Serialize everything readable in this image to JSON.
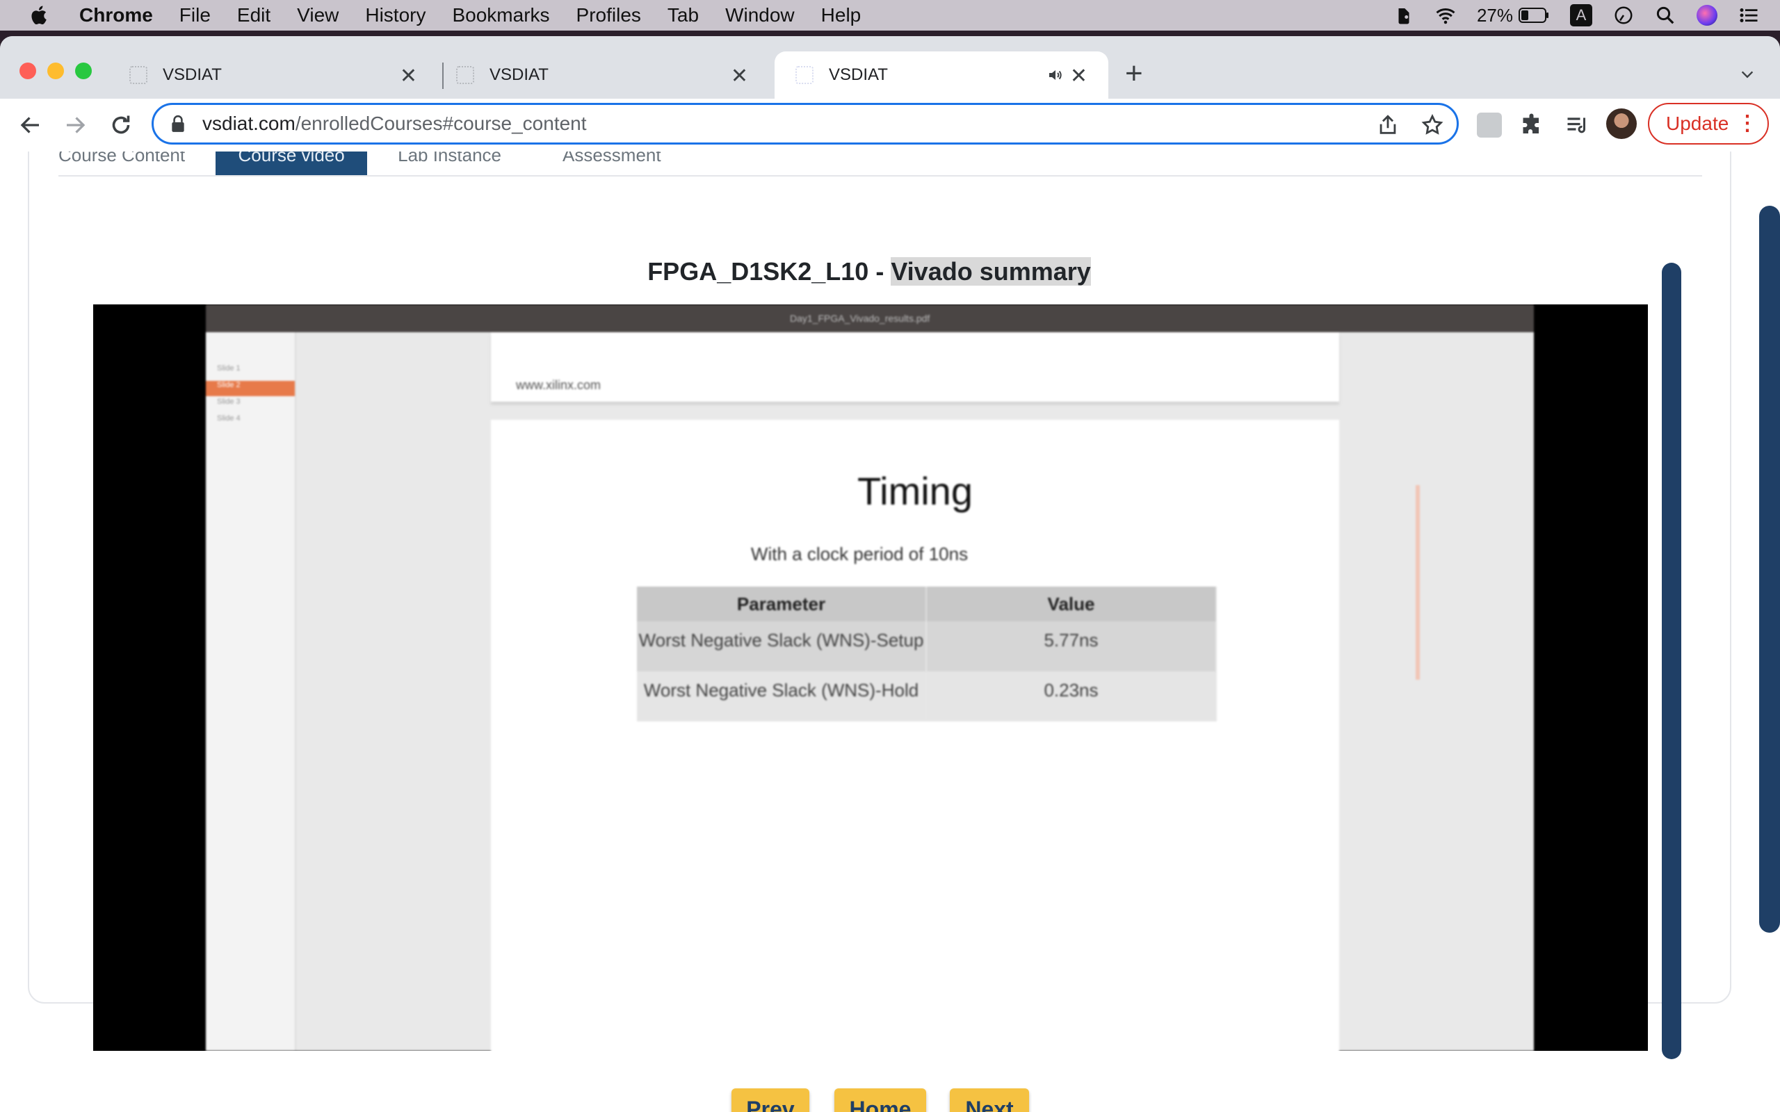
{
  "menubar": {
    "app_name": "Chrome",
    "items": [
      "File",
      "Edit",
      "View",
      "History",
      "Bookmarks",
      "Profiles",
      "Tab",
      "Window",
      "Help"
    ],
    "battery_percent": "27%",
    "input_source": "A"
  },
  "browser": {
    "tabs": [
      {
        "title": "VSDIAT",
        "active": false
      },
      {
        "title": "VSDIAT",
        "active": false
      },
      {
        "title": "VSDIAT",
        "active": true,
        "audio": true
      }
    ],
    "url_host": "vsdiat.com",
    "url_path": "/enrolledCourses#course_content",
    "update_label": "Update"
  },
  "course": {
    "tabs": [
      "Course Content",
      "Course video",
      "Lab Instance",
      "Assessment"
    ],
    "active_tab": "Course video",
    "video_title_prefix": "FPGA_D1SK2_L10 - ",
    "video_title_highlight": "Vivado summary"
  },
  "video": {
    "viewer_filename": "Day1_FPGA_Vivado_results.pdf",
    "sidebar_items": [
      "Slide 1",
      "Slide 2",
      "Slide 3",
      "Slide 4"
    ],
    "page_header_url": "www.xilinx.com",
    "slide_title": "Timing",
    "slide_subtitle": "With a clock period of 10ns",
    "table_headers": [
      "Parameter",
      "Value"
    ],
    "table_rows": [
      {
        "parameter": "Worst Negative Slack (WNS)-Setup",
        "value": "5.77ns"
      },
      {
        "parameter": "Worst Negative Slack (WNS)-Hold",
        "value": "0.23ns"
      }
    ]
  },
  "nav_buttons": {
    "prev": "Prev",
    "home": "Home",
    "next": "Next"
  },
  "colors": {
    "accent_navy": "#1f3f66",
    "button_yellow": "#f5c242",
    "chrome_blue": "#1a73e8",
    "update_red": "#d93025"
  }
}
